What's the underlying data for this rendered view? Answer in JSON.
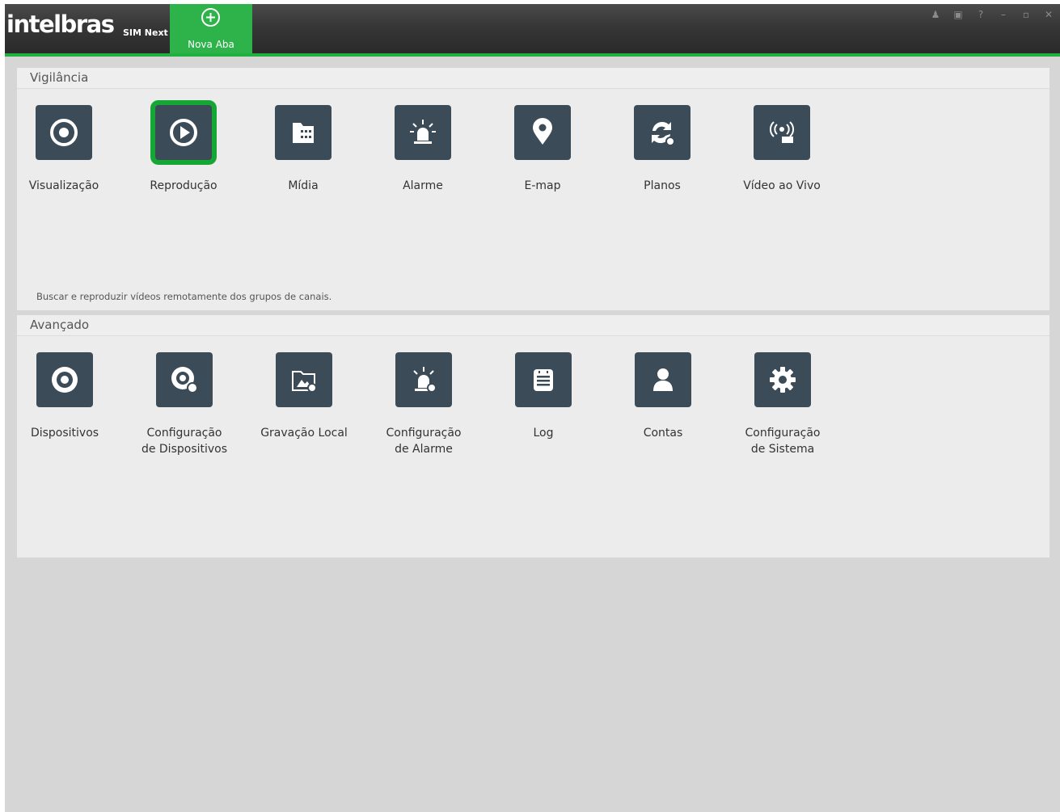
{
  "app": {
    "brand": "intelbras",
    "product": "SIM Next",
    "new_tab_label": "Nova Aba"
  },
  "window_controls": [
    "user-icon",
    "lock-icon",
    "help-icon",
    "minimize-icon",
    "maximize-icon",
    "close-icon"
  ],
  "colors": {
    "accent": "#1fb03f",
    "tile_bg": "#3b4b57",
    "selected_border": "#16a635"
  },
  "vigilancia": {
    "title": "Vigilância",
    "description": "Buscar e reproduzir vídeos remotamente dos grupos de canais.",
    "items": [
      {
        "label": "Visualização",
        "icon": "eye-icon"
      },
      {
        "label": "Reprodução",
        "icon": "play-icon",
        "selected": true
      },
      {
        "label": "Mídia",
        "icon": "media-icon"
      },
      {
        "label": "Alarme",
        "icon": "alarm-icon"
      },
      {
        "label": "E-map",
        "icon": "map-pin-icon"
      },
      {
        "label": "Planos",
        "icon": "plans-icon"
      },
      {
        "label": "Vídeo ao Vivo",
        "icon": "live-video-icon"
      }
    ]
  },
  "avancado": {
    "title": "Avançado",
    "items": [
      {
        "label": "Dispositivos",
        "icon": "camera-icon"
      },
      {
        "label": "Configuração de Dispositivos",
        "icon": "device-config-icon"
      },
      {
        "label": "Gravação Local",
        "icon": "local-record-icon"
      },
      {
        "label": "Configuração de Alarme",
        "icon": "alarm-config-icon"
      },
      {
        "label": "Log",
        "icon": "log-icon"
      },
      {
        "label": "Contas",
        "icon": "account-icon"
      },
      {
        "label": "Configuração de Sistema",
        "icon": "system-config-icon"
      }
    ]
  }
}
